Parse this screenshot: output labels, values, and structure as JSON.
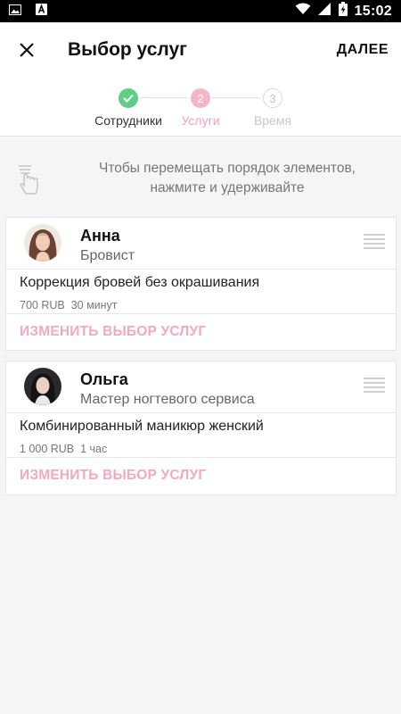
{
  "status_bar": {
    "time": "15:02",
    "icons": [
      "image-icon",
      "a-app-icon",
      "wifi-icon",
      "signal-icon",
      "battery-charging-icon"
    ]
  },
  "app_bar": {
    "title": "Выбор услуг",
    "next_label": "ДАЛЕЕ",
    "close_icon": "close-icon"
  },
  "stepper": {
    "steps": [
      {
        "label": "Сотрудники",
        "state": "done",
        "marker": ""
      },
      {
        "label": "Услуги",
        "state": "active",
        "marker": "2"
      },
      {
        "label": "Время",
        "state": "pending",
        "marker": "3"
      }
    ]
  },
  "hint": {
    "text_line1": "Чтобы перемещать порядок элементов,",
    "text_line2": "нажмите и удерживайте",
    "icon": "touch-hold-icon"
  },
  "employees": [
    {
      "name": "Анна",
      "role": "Бровист",
      "service_name": "Коррекция бровей без окрашивания",
      "service_price": "700 RUB",
      "service_duration": "30 минут",
      "change_label": "ИЗМЕНИТЬ ВЫБОР УСЛУГ"
    },
    {
      "name": "Ольга",
      "role": "Мастер ногтевого сервиса",
      "service_name": "Комбинированный маникюр женский",
      "service_price": "1 000 RUB",
      "service_duration": "1 час",
      "change_label": "ИЗМЕНИТЬ ВЫБОР УСЛУГ"
    }
  ],
  "colors": {
    "accent_pink": "#f3a9bd",
    "done_green": "#5fcf86"
  }
}
